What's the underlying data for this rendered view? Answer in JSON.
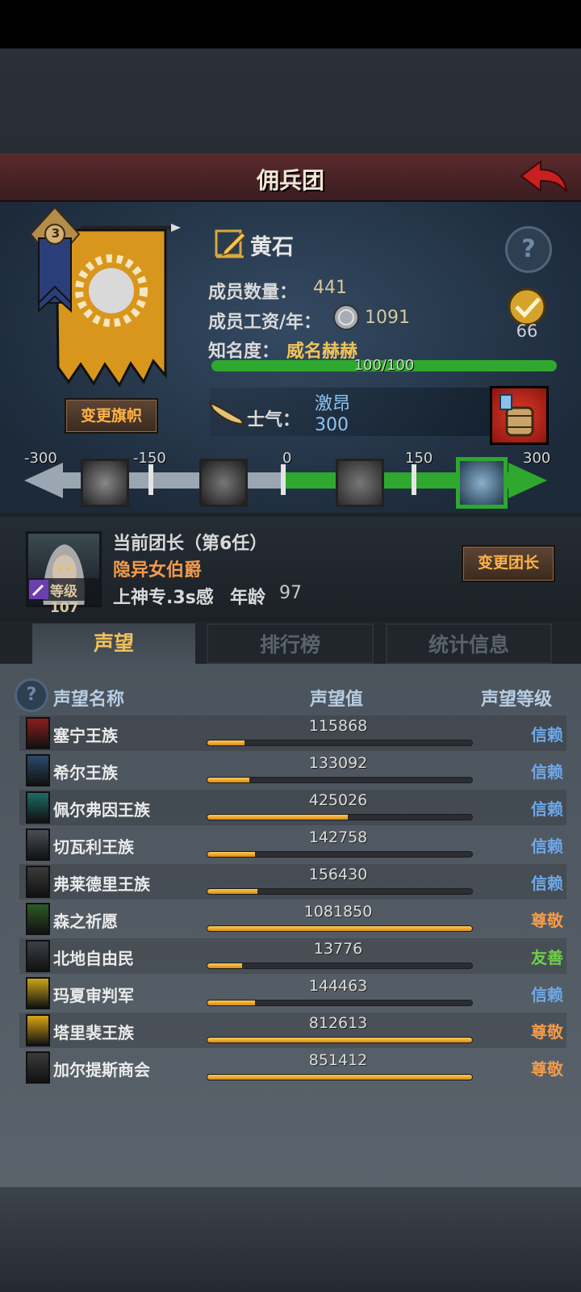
{
  "header": {
    "title": "佣兵团"
  },
  "mercenary": {
    "rank_badge": "3",
    "change_flag_label": "变更旗帜",
    "name": "黄石",
    "members_label": "成员数量：",
    "members_value": "441",
    "wage_label": "成员工资/年：",
    "wage_value": "1091",
    "fame_label": "知名度：",
    "fame_value": "威名赫赫",
    "fame_progress": "100/100",
    "fame_fraction": 1.0,
    "badge_count": "66",
    "morale_label": "士气：",
    "morale_state": "激昂",
    "morale_value": "300"
  },
  "morale_scale": {
    "ticks": [
      "-300",
      "-150",
      "0",
      "150",
      "300"
    ],
    "current": 300,
    "min": -300,
    "max": 300
  },
  "leader": {
    "heading": "当前团长（第6任）",
    "title": "隐异女伯爵",
    "level_label": "等级107",
    "traits": "上神专.3s感",
    "age_label": "年龄",
    "age_value": "97",
    "change_leader_label": "变更团长"
  },
  "tabs": [
    {
      "label": "声望"
    },
    {
      "label": "排行榜"
    },
    {
      "label": "统计信息"
    }
  ],
  "table": {
    "headers": {
      "name": "声望名称",
      "value": "声望值",
      "level": "声望等级"
    },
    "rows": [
      {
        "name": "塞宁王族",
        "value": "115868",
        "fraction": 0.14,
        "level": "信赖",
        "level_color": "#6ea8ea",
        "icon_color": "#8c1d1d"
      },
      {
        "name": "希尔王族",
        "value": "133092",
        "fraction": 0.16,
        "level": "信赖",
        "level_color": "#6ea8ea",
        "icon_color": "#2a4a6a"
      },
      {
        "name": "佩尔弗因王族",
        "value": "425026",
        "fraction": 0.53,
        "level": "信赖",
        "level_color": "#6ea8ea",
        "icon_color": "#1f6a66"
      },
      {
        "name": "切瓦利王族",
        "value": "142758",
        "fraction": 0.18,
        "level": "信赖",
        "level_color": "#6ea8ea",
        "icon_color": "#4a4f55"
      },
      {
        "name": "弗莱德里王族",
        "value": "156430",
        "fraction": 0.19,
        "level": "信赖",
        "level_color": "#6ea8ea",
        "icon_color": "#3a3a3a"
      },
      {
        "name": "森之祈愿",
        "value": "1081850",
        "fraction": 1.0,
        "level": "尊敬",
        "level_color": "#f29a4a",
        "icon_color": "#2d5a24"
      },
      {
        "name": "北地自由民",
        "value": "13776",
        "fraction": 0.13,
        "level": "友善",
        "level_color": "#6fcf4a",
        "icon_color": "#3a4048"
      },
      {
        "name": "玛夏审判军",
        "value": "144463",
        "fraction": 0.18,
        "level": "信赖",
        "level_color": "#6ea8ea",
        "icon_color": "#c9a417"
      },
      {
        "name": "塔里裴王族",
        "value": "812613",
        "fraction": 1.0,
        "level": "尊敬",
        "level_color": "#f29a4a",
        "icon_color": "#d9a514"
      },
      {
        "name": "加尔提斯商会",
        "value": "851412",
        "fraction": 1.0,
        "level": "尊敬",
        "level_color": "#f29a4a",
        "icon_color": "#3a3a3a"
      }
    ]
  }
}
